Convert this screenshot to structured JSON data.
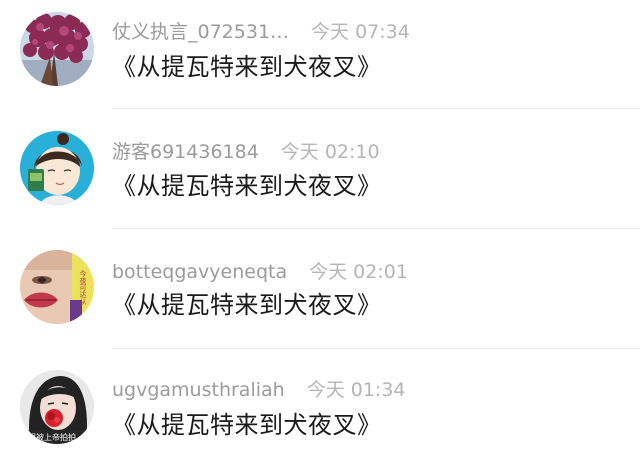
{
  "comments": [
    {
      "username": "仗义执言_072531…",
      "time": "今天 07:34",
      "text": "《从提瓦特来到犬夜叉》",
      "avatar": "flowers-avatar"
    },
    {
      "username": "游客691436184",
      "time": "今天 02:10",
      "text": "《从提瓦特来到犬夜叉》",
      "avatar": "cartoon-girl-avatar"
    },
    {
      "username": "botteqgavyeneqta",
      "time": "今天 02:01",
      "text": "《从提瓦特来到犬夜叉》",
      "avatar": "face-closeup-avatar",
      "avatar_text": "今夜可达从"
    },
    {
      "username": "ugvgamusthraliah",
      "time": "今天 01:34",
      "text": "《从提瓦特来到犬夜叉》",
      "avatar": "girl-with-rose-avatar",
      "avatar_text": "想被上帝拍拍"
    }
  ]
}
